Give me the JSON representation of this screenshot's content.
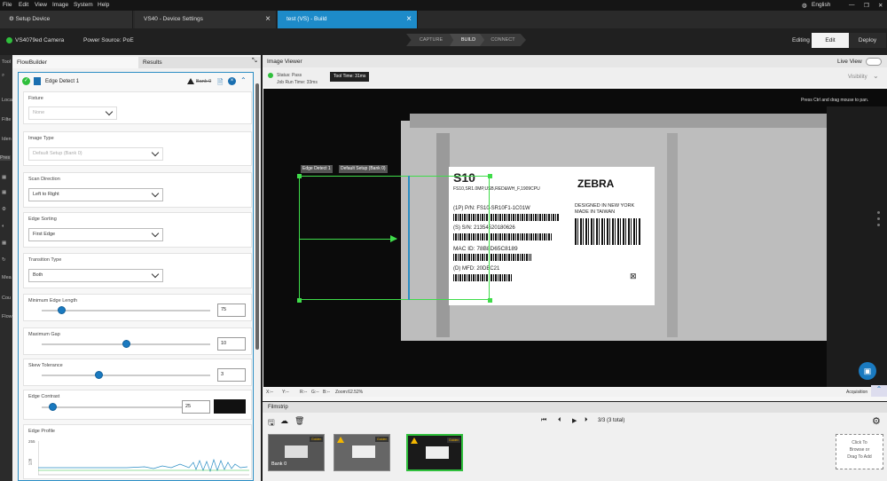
{
  "menu": [
    "File",
    "Edit",
    "View",
    "Image",
    "System",
    "Help"
  ],
  "language": "English",
  "tabs": [
    {
      "label": "Setup Device"
    },
    {
      "label": "VS40 - Device Settings"
    },
    {
      "label": "test  (VS) - Build"
    }
  ],
  "toolbar": {
    "camera": "VS4079ed Camera",
    "power": "Power Source: PoE",
    "steps": [
      "CAPTURE",
      "BUILD",
      "CONNECT"
    ],
    "editing": "Editing",
    "edit": "Edit",
    "deploy": "Deploy"
  },
  "left_rail": [
    "Tool",
    "Loca",
    "Filte",
    "Iden",
    "Pres",
    "Mea",
    "Cou",
    "Flow"
  ],
  "flowbuilder": {
    "tab_flow": "FlowBuilder",
    "tab_results": "Results",
    "tool_title": "Edge Detect 1",
    "bank": "Bank 0",
    "fixture": {
      "label": "Fixture",
      "value": "None"
    },
    "image_type": {
      "label": "Image Type",
      "value": "Default Setup (Bank 0)"
    },
    "scan_direction": {
      "label": "Scan Direction",
      "value": "Left to Right"
    },
    "edge_sorting": {
      "label": "Edge Sorting",
      "value": "First Edge"
    },
    "transition_type": {
      "label": "Transition Type",
      "value": "Both"
    },
    "min_edge_length": {
      "label": "Minimum Edge Length",
      "value": "75",
      "fraction": 0.12
    },
    "max_gap": {
      "label": "Maximum Gap",
      "value": "10",
      "fraction": 0.5
    },
    "skew_tolerance": {
      "label": "Skew Tolerance",
      "value": "3",
      "fraction": 0.34
    },
    "edge_contrast": {
      "label": "Edge Contrast",
      "value": "25",
      "fraction": 0.08
    },
    "edge_profile": {
      "label": "Edge Profile",
      "y_max": "255",
      "y_mid": "128"
    }
  },
  "image_viewer": {
    "title": "Image Viewer",
    "live_view": "Live View",
    "status": "Status: Pass",
    "job_run_time": "Job Run Time: 33ms",
    "tool_time": "Tool Time: 31ms",
    "visibility": "Visibility",
    "hint": "Press Ctrl and drag mouse to pan.",
    "roi_label_1": "Edge Detect 1",
    "roi_label_2": "Default Setup (Bank 0)",
    "coords": {
      "x": "X:--",
      "y": "Y:--",
      "r": "R:--",
      "g": "G:--",
      "b": "B:--",
      "zoom": "Zoom:62.52%"
    },
    "acquisition": "Acquisition"
  },
  "label": {
    "model": "S10",
    "line1": "FS10,SR1.0MP,USB,RED&WH_F,1909CPU",
    "pn": "(1P) P/N:  FS10-SR10F1-1C01W",
    "sn": "(S) S/N:  21354520180626",
    "mac": "MAC ID:  78B8D65C8189",
    "mfd": "(D) MFD:  20DEC21",
    "brand": "ZEBRA",
    "design1": "DESIGNED IN NEW YORK",
    "design2": "MADE IN TAIWAN"
  },
  "filmstrip": {
    "title": "Filmstrip",
    "count": "3/3 (3 total)",
    "thumb_label": "Bank 0",
    "thumb_badge": "Golden",
    "drag_add": [
      "Click To",
      "Browse or",
      "Drag To Add"
    ]
  },
  "colors": {
    "accent": "#1d8bc9",
    "pass": "#2fbf3c",
    "roi": "#3fdc4a"
  }
}
